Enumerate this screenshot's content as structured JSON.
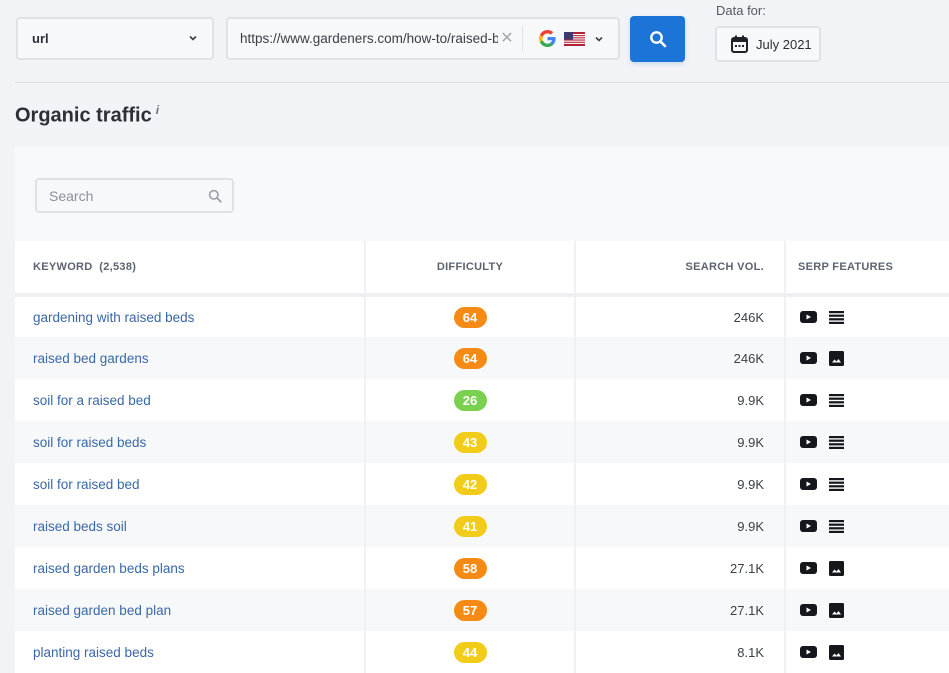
{
  "topbar": {
    "mode_select": {
      "value": "url"
    },
    "url_input": {
      "value": "https://www.gardeners.com/how-to/raised-beds"
    },
    "engine": {
      "name": "Google",
      "country": "United States"
    },
    "search_button_icon": "search-icon",
    "data_for_label": "Data for:",
    "date_button": {
      "label": "July 2021",
      "icon": "calendar-icon"
    }
  },
  "section": {
    "title": "Organic traffic",
    "info_marker": "i"
  },
  "table_search": {
    "placeholder": "Search",
    "value": ""
  },
  "table": {
    "columns": {
      "keyword": "KEYWORD",
      "keyword_count": "(2,538)",
      "difficulty": "DIFFICULTY",
      "search_vol": "SEARCH VOL.",
      "serp_features": "SERP FEATURES"
    },
    "difficulty_colors": {
      "easy": "#7ad150",
      "medium": "#f2cc1a",
      "hard": "#f58b14"
    },
    "rows": [
      {
        "keyword": "gardening with raised beds",
        "difficulty": "64",
        "level": "hard",
        "volume": "246K",
        "serp": [
          "video",
          "list"
        ]
      },
      {
        "keyword": "raised bed gardens",
        "difficulty": "64",
        "level": "hard",
        "volume": "246K",
        "serp": [
          "video",
          "image"
        ]
      },
      {
        "keyword": "soil for a raised bed",
        "difficulty": "26",
        "level": "easy",
        "volume": "9.9K",
        "serp": [
          "video",
          "list"
        ]
      },
      {
        "keyword": "soil for raised beds",
        "difficulty": "43",
        "level": "medium",
        "volume": "9.9K",
        "serp": [
          "video",
          "list"
        ]
      },
      {
        "keyword": "soil for raised bed",
        "difficulty": "42",
        "level": "medium",
        "volume": "9.9K",
        "serp": [
          "video",
          "list"
        ]
      },
      {
        "keyword": "raised beds soil",
        "difficulty": "41",
        "level": "medium",
        "volume": "9.9K",
        "serp": [
          "video",
          "list"
        ]
      },
      {
        "keyword": "raised garden beds plans",
        "difficulty": "58",
        "level": "hard",
        "volume": "27.1K",
        "serp": [
          "video",
          "image"
        ]
      },
      {
        "keyword": "raised garden bed plan",
        "difficulty": "57",
        "level": "hard",
        "volume": "27.1K",
        "serp": [
          "video",
          "image"
        ]
      },
      {
        "keyword": "planting raised beds",
        "difficulty": "44",
        "level": "medium",
        "volume": "8.1K",
        "serp": [
          "video",
          "image"
        ]
      }
    ]
  },
  "colors": {
    "accent": "#1c74d6",
    "link": "#3a68a6",
    "background": "#f2f3f7"
  }
}
